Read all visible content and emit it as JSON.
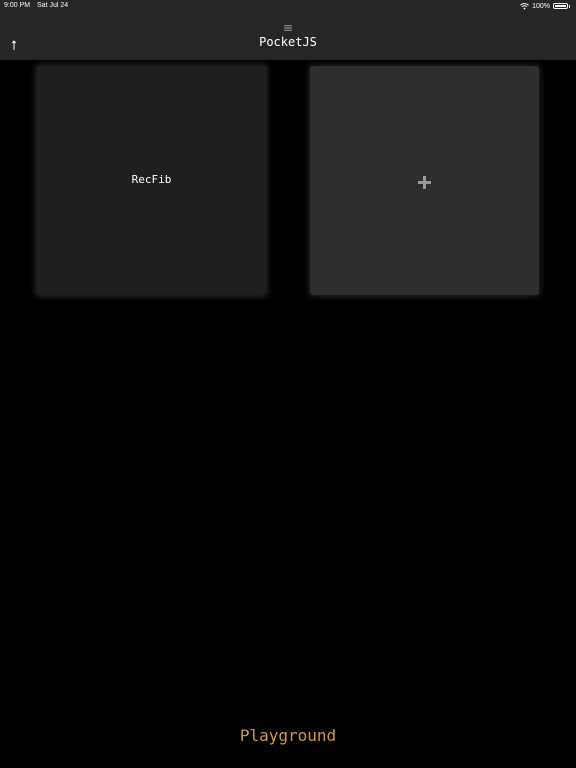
{
  "status_bar": {
    "time": "9:00 PM",
    "date": "Sat Jul 24",
    "battery_percent": "100%",
    "wifi_icon": "wifi-icon",
    "battery_level": 1.0
  },
  "nav": {
    "title": "PocketJS",
    "back_icon": "arrow-up-icon"
  },
  "projects": [
    {
      "label": "RecFib"
    }
  ],
  "add_card": {
    "icon": "plus-icon"
  },
  "bottom": {
    "label": "Playground"
  },
  "colors": {
    "background": "#000000",
    "bar": "#262626",
    "project_card": "#1f1f1f",
    "add_card": "#2e2e2e",
    "accent": "#d39a3e",
    "plus": "#9a9a9a"
  }
}
